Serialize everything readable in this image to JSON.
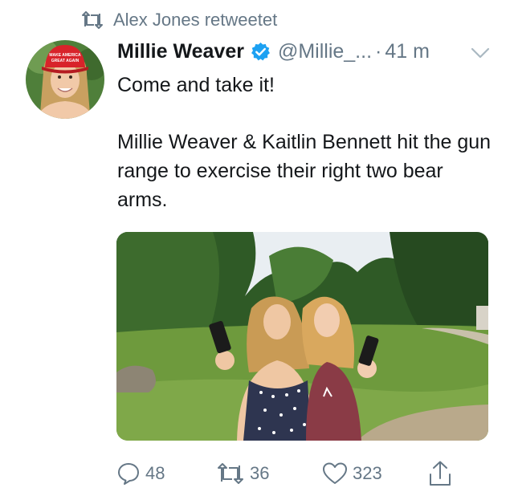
{
  "retweet": {
    "icon": "retweet-icon",
    "text": "Alex Jones retweetet"
  },
  "tweet": {
    "author_name": "Millie Weaver",
    "verified": true,
    "handle": "@Millie_...",
    "separator": "·",
    "time": "41 m",
    "avatar_cap_text": "MAKE AMERICA GREAT AGAIN",
    "text_lines": [
      "Come and take it!",
      "Millie Weaver & Kaitlin Bennett hit the gun range to exercise their right two bear arms."
    ]
  },
  "actions": {
    "reply": {
      "icon": "reply-icon",
      "count": "48"
    },
    "retweet": {
      "icon": "retweet-icon",
      "count": "36"
    },
    "like": {
      "icon": "heart-icon",
      "count": "323"
    },
    "share": {
      "icon": "share-icon"
    }
  },
  "colors": {
    "text": "#14171a",
    "secondary": "#657786",
    "verified": "#1da1f2"
  }
}
